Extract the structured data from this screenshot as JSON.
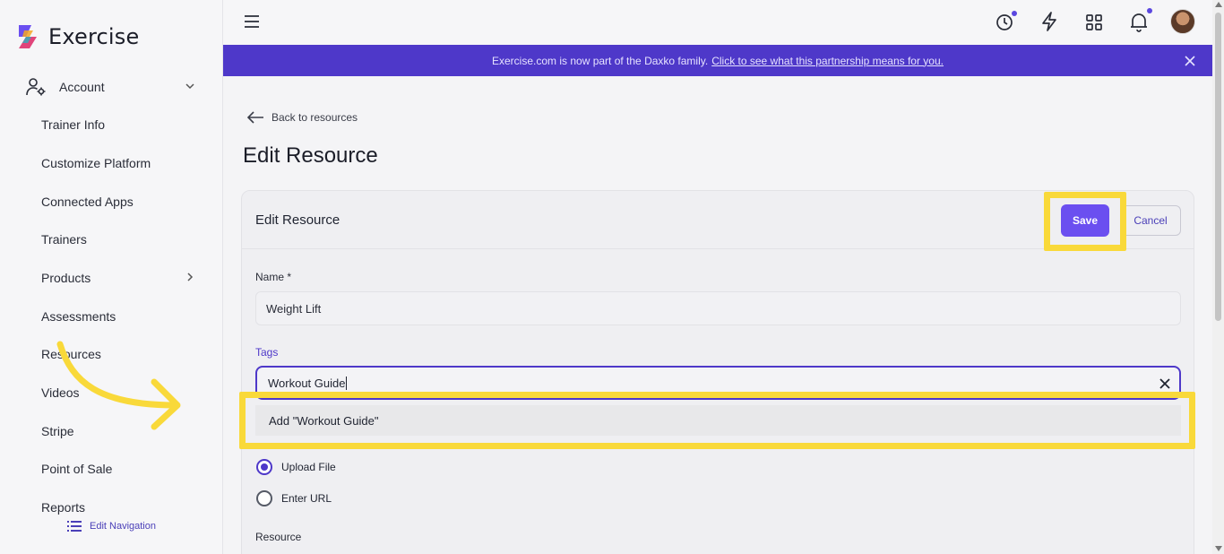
{
  "sidebar": {
    "logo_text": "Exercise",
    "account_label": "Account",
    "items": [
      {
        "label": "Trainer Info"
      },
      {
        "label": "Customize Platform"
      },
      {
        "label": "Connected Apps"
      },
      {
        "label": "Trainers"
      },
      {
        "label": "Products"
      },
      {
        "label": "Assessments"
      },
      {
        "label": "Resources"
      },
      {
        "label": "Videos"
      },
      {
        "label": "Stripe"
      },
      {
        "label": "Point of Sale"
      },
      {
        "label": "Reports"
      }
    ],
    "edit_nav_label": "Edit Navigation"
  },
  "banner": {
    "text": "Exercise.com is now part of the Daxko family.",
    "link": "Click to see what this partnership means for you."
  },
  "main": {
    "back_label": "Back to resources",
    "page_title": "Edit Resource",
    "card_title": "Edit Resource",
    "save_label": "Save",
    "cancel_label": "Cancel",
    "name_label": "Name *",
    "name_value": "Weight Lift",
    "tags_label": "Tags",
    "tags_value": "Workout Guide",
    "dropdown_option": "Add \"Workout Guide\"",
    "radio_upload": "Upload File",
    "radio_url": "Enter URL",
    "resource_label": "Resource"
  },
  "colors": {
    "accent": "#4e38c9",
    "button": "#6b4ff0",
    "highlight": "#f9d93a"
  },
  "icons": [
    "hamburger-icon",
    "history-icon",
    "lightning-icon",
    "apps-grid-icon",
    "bell-icon",
    "close-icon",
    "arrow-left-icon",
    "account-settings-icon",
    "chevron-down-icon",
    "chevron-right-icon",
    "list-icon"
  ]
}
